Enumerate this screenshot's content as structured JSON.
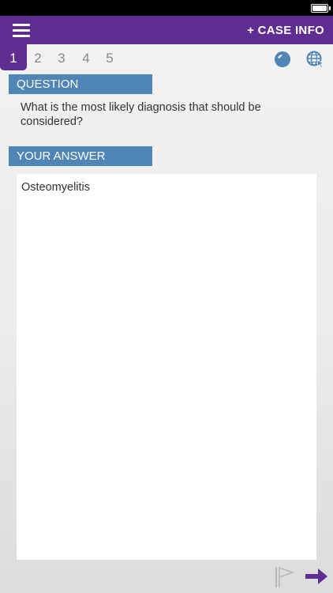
{
  "header": {
    "case_info_label": "+ CASE INFO",
    "menu_icon": "hamburger-menu-icon",
    "color": "#5f2c91"
  },
  "tabs": [
    {
      "label": "1",
      "active": true
    },
    {
      "label": "2",
      "active": false
    },
    {
      "label": "3",
      "active": false
    },
    {
      "label": "4",
      "active": false
    },
    {
      "label": "5",
      "active": false
    }
  ],
  "toolbar_icons": [
    "globe-icon",
    "web-search-icon"
  ],
  "question": {
    "header": "QUESTION",
    "text": "What is the most likely diagnosis that should be considered?"
  },
  "answer": {
    "header": "YOUR ANSWER",
    "value": "Osteomyelitis"
  },
  "footer_icons": [
    "flag-icon",
    "next-arrow-icon"
  ],
  "colors": {
    "accent": "#5f2c91",
    "section_header": "#4f85b7"
  }
}
